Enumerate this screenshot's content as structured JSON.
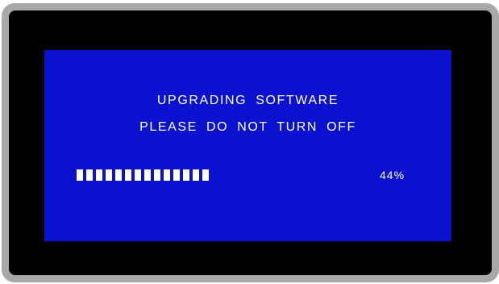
{
  "screen": {
    "title": "UPGRADING SOFTWARE",
    "warning": "PLEASE DO NOT TURN OFF"
  },
  "progress": {
    "percent_label": "44%",
    "percent_value": 44,
    "segments_filled": 14,
    "segments_total": 32
  },
  "colors": {
    "screen_background": "#0a12cf",
    "text": "#ffffff",
    "bezel": "#000000",
    "frame": "#a8a8a8"
  }
}
